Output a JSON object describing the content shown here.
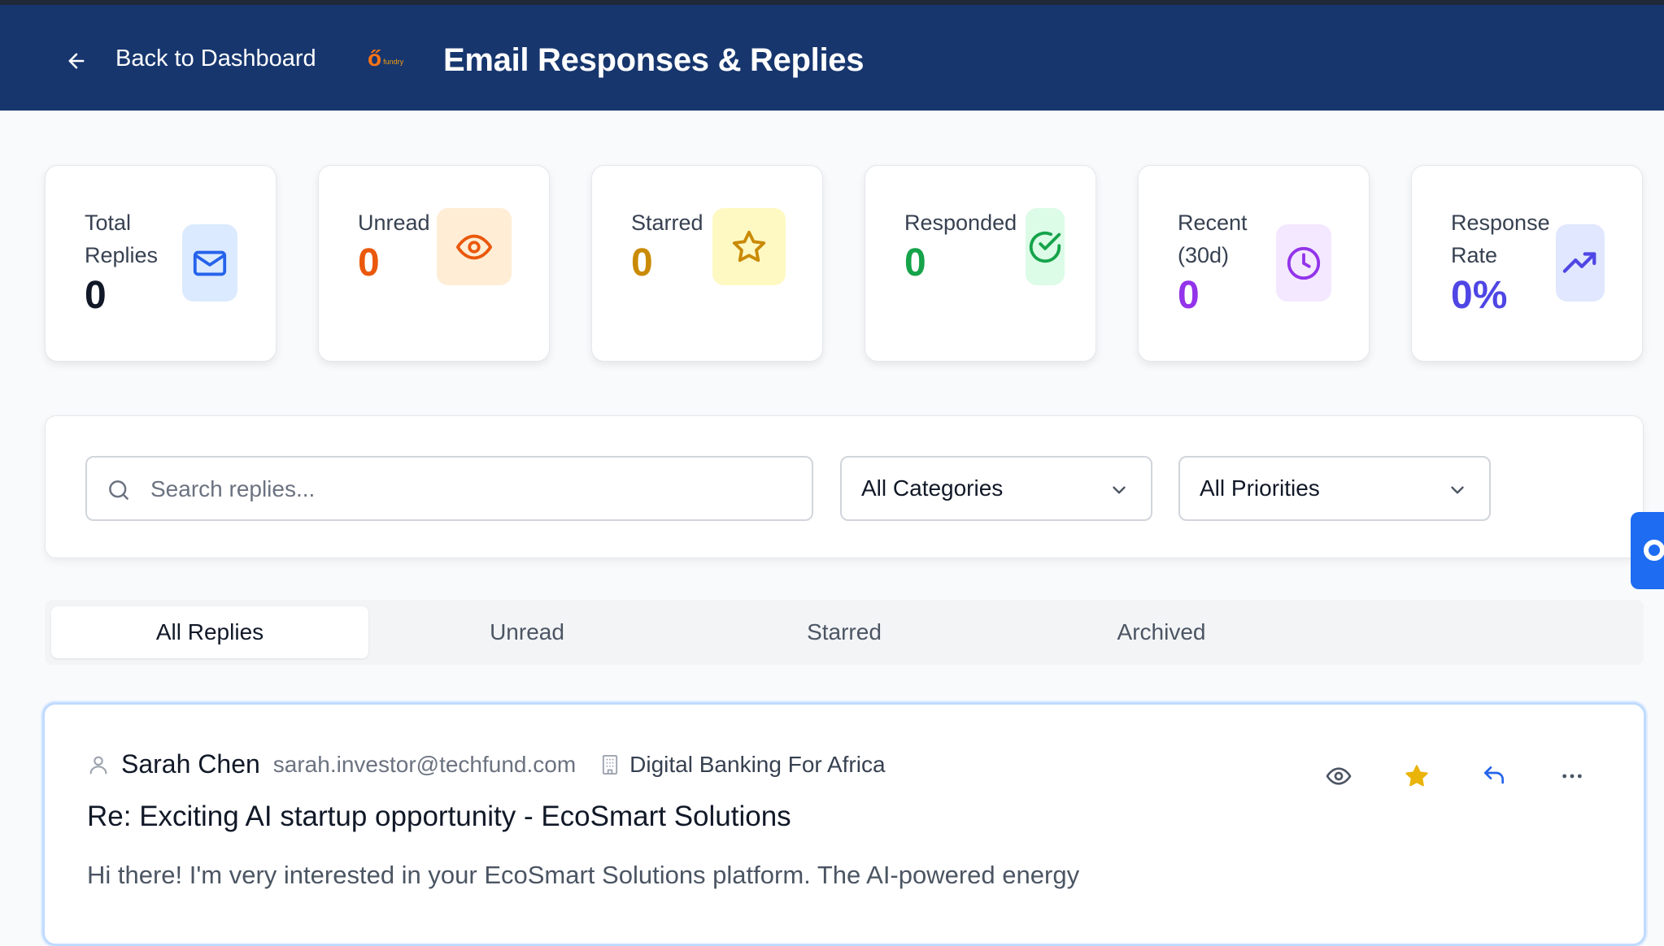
{
  "header": {
    "back_label": "Back to Dashboard",
    "logo_text": "fundry",
    "title": "Email Responses & Replies"
  },
  "stats": [
    {
      "label": "Total Replies",
      "value": "0",
      "icon": "mail-icon",
      "color": "#111827",
      "icon_bg": "#dbeafe",
      "icon_color": "#2563eb"
    },
    {
      "label": "Unread",
      "value": "0",
      "icon": "eye-icon",
      "color": "#ea580c",
      "icon_bg": "#ffedd5",
      "icon_color": "#ea580c"
    },
    {
      "label": "Starred",
      "value": "0",
      "icon": "star-icon",
      "color": "#ca8a04",
      "icon_bg": "#fef9c3",
      "icon_color": "#ca8a04"
    },
    {
      "label": "Responded",
      "value": "0",
      "icon": "check-circle-icon",
      "color": "#16a34a",
      "icon_bg": "#dcfce7",
      "icon_color": "#16a34a"
    },
    {
      "label": "Recent (30d)",
      "value": "0",
      "icon": "clock-icon",
      "color": "#9333ea",
      "icon_bg": "#f3e8ff",
      "icon_color": "#9333ea"
    },
    {
      "label": "Response Rate",
      "value": "0%",
      "icon": "trending-up-icon",
      "color": "#4f46e5",
      "icon_bg": "#e0e7ff",
      "icon_color": "#4f46e5"
    }
  ],
  "filters": {
    "search_placeholder": "Search replies...",
    "category": "All Categories",
    "priority": "All Priorities"
  },
  "tabs": [
    {
      "label": "All Replies",
      "active": true
    },
    {
      "label": "Unread",
      "active": false
    },
    {
      "label": "Starred",
      "active": false
    },
    {
      "label": "Archived",
      "active": false
    }
  ],
  "reply": {
    "sender_name": "Sarah Chen",
    "sender_email": "sarah.investor@techfund.com",
    "company": "Digital Banking For Africa",
    "subject": "Re: Exciting AI startup opportunity - EcoSmart Solutions",
    "preview": "Hi there! I'm very interested in your EcoSmart Solutions platform. The AI-powered energy",
    "starred": true
  },
  "colors": {
    "header_bg": "#17366e",
    "accent_blue": "#1d6cf2",
    "star_gold": "#eab308"
  }
}
